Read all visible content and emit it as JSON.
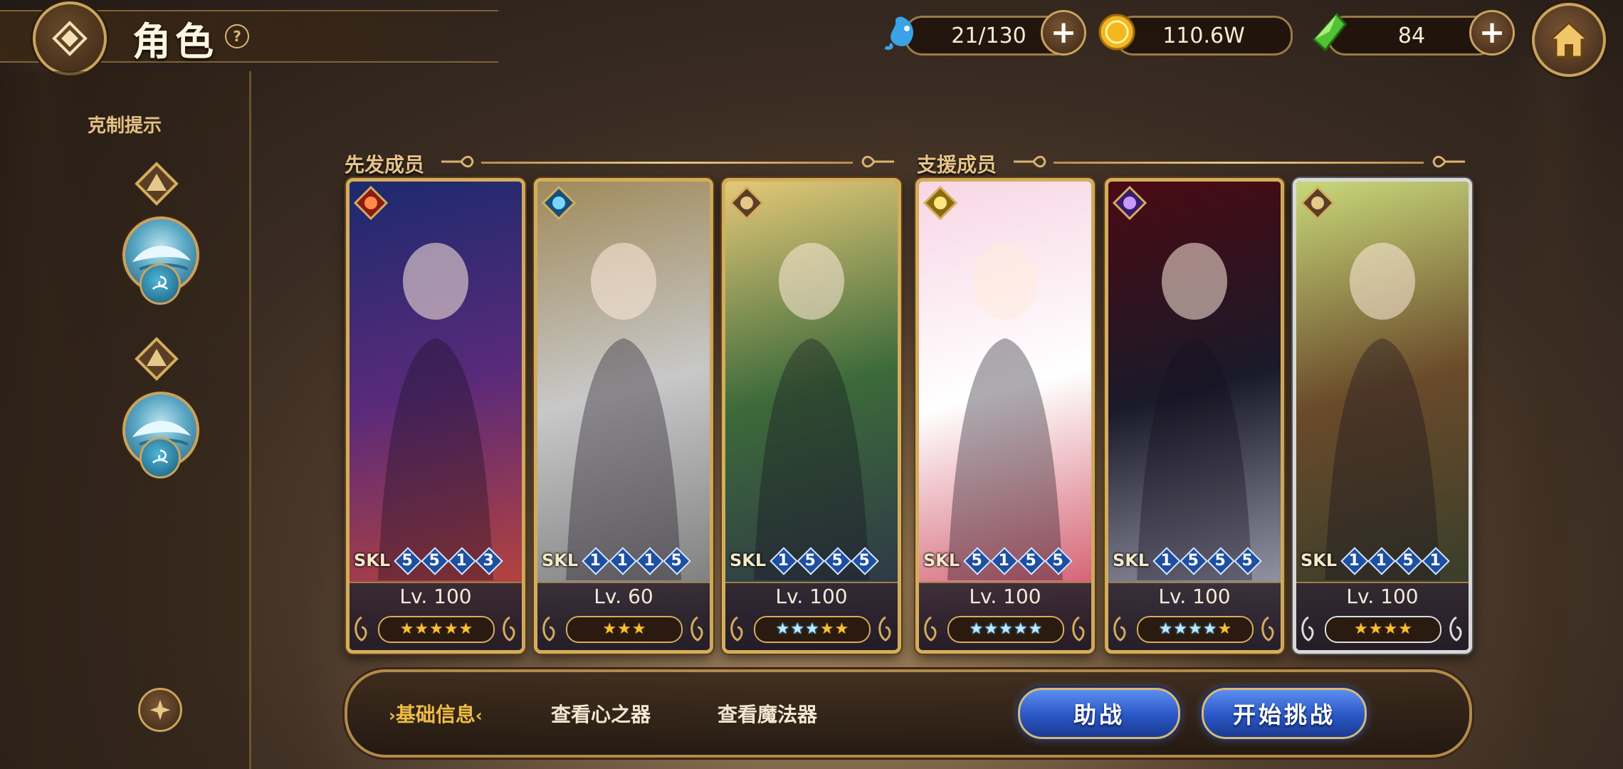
{
  "header": {
    "title": "角色",
    "help_symbol": "?",
    "resources": [
      {
        "name": "stamina",
        "icon": "water-spirit-icon",
        "value": "21/130",
        "addable": true
      },
      {
        "name": "gold",
        "icon": "gold-coin-icon",
        "value": "110.6W",
        "addable": false
      },
      {
        "name": "gems",
        "icon": "green-crystal-icon",
        "value": "84",
        "addable": true
      }
    ]
  },
  "sidebar": {
    "counter_title": "克制提示",
    "counters": [
      {
        "player_element": "earth",
        "enemy_element": "water"
      },
      {
        "player_element": "earth",
        "enemy_element": "water"
      }
    ]
  },
  "sections": {
    "starters_label": "先发成员",
    "support_label": "支援成员"
  },
  "cards": [
    {
      "element": "fire",
      "skl_label": "SKL",
      "skl": [
        "5",
        "5",
        "1",
        "3"
      ],
      "level": "Lv. 100",
      "stars": [
        0,
        0,
        0,
        0,
        0
      ],
      "frame": "gold"
    },
    {
      "element": "water",
      "skl_label": "SKL",
      "skl": [
        "1",
        "1",
        "1",
        "5"
      ],
      "level": "Lv. 60",
      "stars": [
        0,
        0,
        0
      ],
      "frame": "gold"
    },
    {
      "element": "earth",
      "skl_label": "SKL",
      "skl": [
        "1",
        "5",
        "5",
        "5"
      ],
      "level": "Lv. 100",
      "stars": [
        1,
        1,
        1,
        0,
        0
      ],
      "frame": "gold"
    },
    {
      "element": "light",
      "skl_label": "SKL",
      "skl": [
        "5",
        "1",
        "5",
        "5"
      ],
      "level": "Lv. 100",
      "stars": [
        1,
        1,
        1,
        1,
        1
      ],
      "frame": "gold"
    },
    {
      "element": "dark",
      "skl_label": "SKL",
      "skl": [
        "1",
        "5",
        "5",
        "5"
      ],
      "level": "Lv. 100",
      "stars": [
        1,
        1,
        1,
        1,
        0
      ],
      "frame": "gold"
    },
    {
      "element": "earth",
      "skl_label": "SKL",
      "skl": [
        "1",
        "1",
        "5",
        "1"
      ],
      "level": "Lv. 100",
      "stars": [
        0,
        0,
        0,
        0
      ],
      "frame": "silver"
    }
  ],
  "bottom": {
    "tabs": [
      "基础信息",
      "查看心之器",
      "查看魔法器"
    ],
    "active_tab": 0,
    "assist_label": "助战",
    "start_label": "开始挑战"
  },
  "colors": {
    "gold_trim": "#d4ad5c",
    "skill_diamond": "#1e4fa0",
    "button_blue": "#2a56c4",
    "active_tab": "#f0bd45"
  }
}
